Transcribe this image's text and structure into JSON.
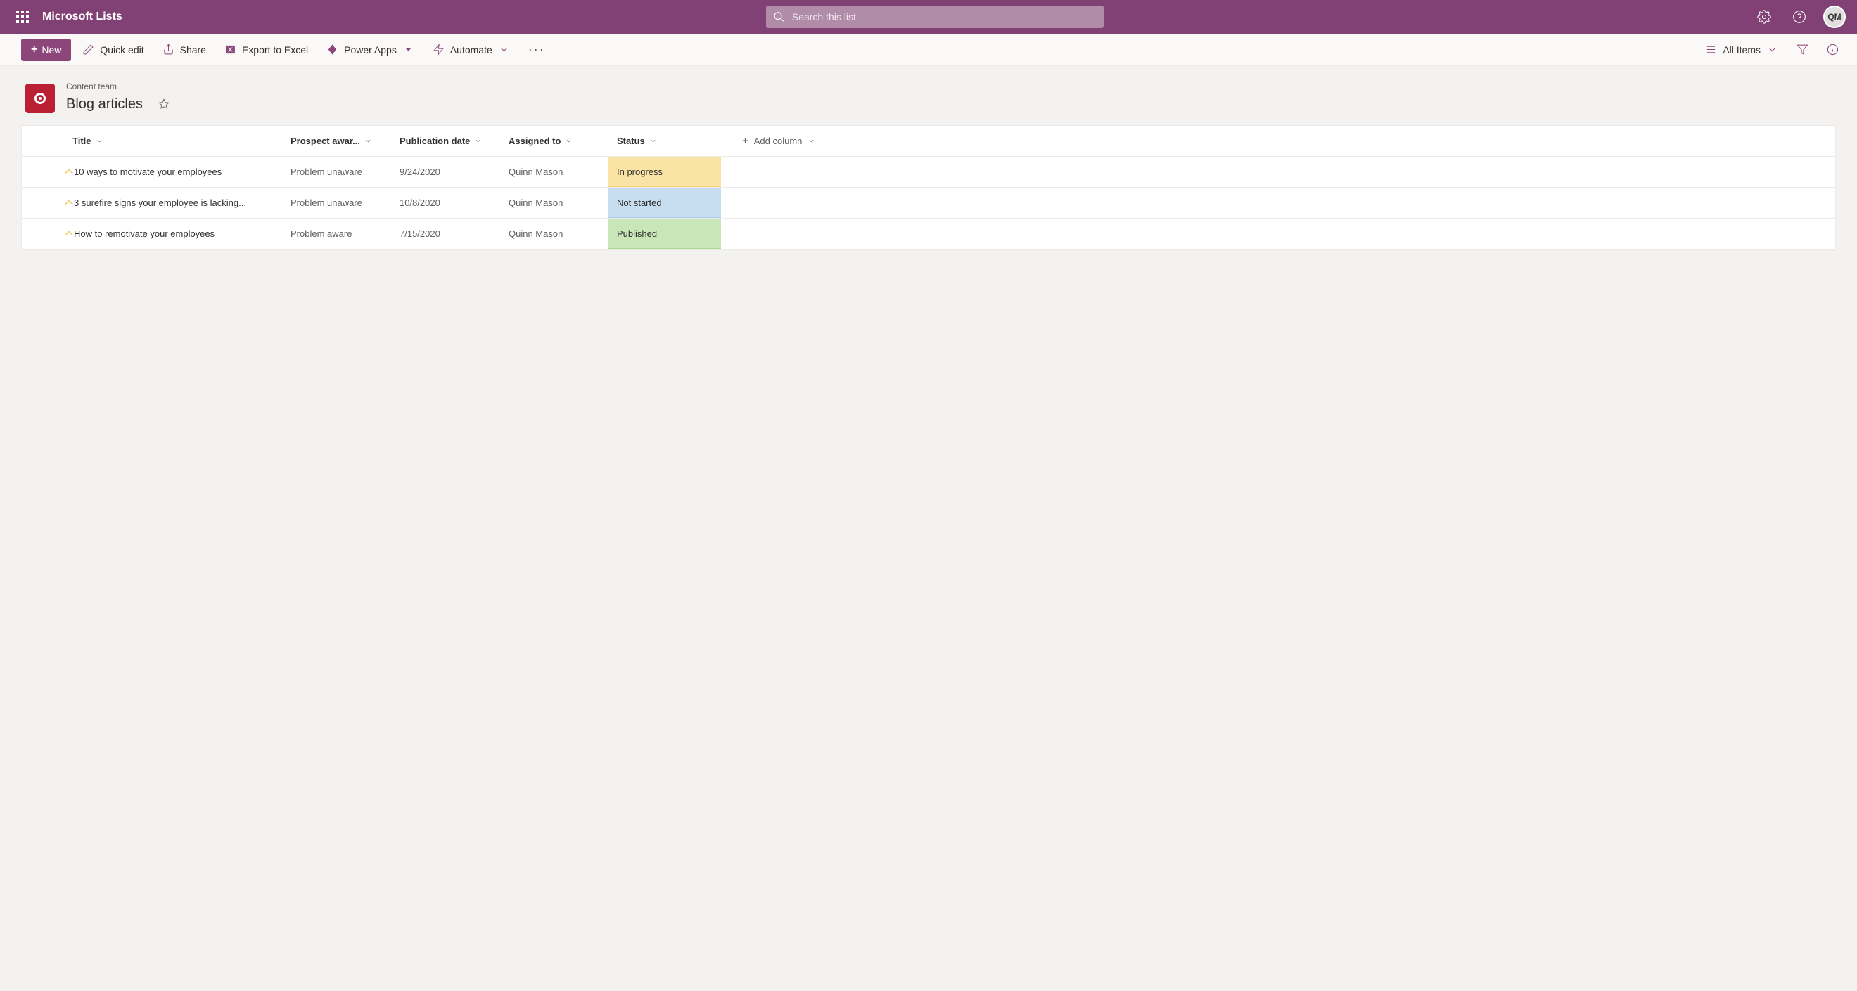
{
  "header": {
    "appTitle": "Microsoft Lists",
    "searchPlaceholder": "Search this list",
    "avatarInitials": "QM"
  },
  "commandBar": {
    "newLabel": "New",
    "quickEditLabel": "Quick edit",
    "shareLabel": "Share",
    "exportLabel": "Export to Excel",
    "powerAppsLabel": "Power Apps",
    "automateLabel": "Automate",
    "viewLabel": "All Items"
  },
  "listHeader": {
    "teamName": "Content team",
    "listName": "Blog articles"
  },
  "columns": {
    "title": "Title",
    "prospect": "Prospect awar...",
    "date": "Publication date",
    "assigned": "Assigned to",
    "status": "Status",
    "add": "Add column"
  },
  "rows": [
    {
      "title": "10 ways to motivate your employees",
      "prospect": "Problem unaware",
      "date": "9/24/2020",
      "assigned": "Quinn Mason",
      "status": "In progress",
      "statusClass": "status-inprogress"
    },
    {
      "title": "3 surefire signs your employee is lacking...",
      "prospect": "Problem unaware",
      "date": "10/8/2020",
      "assigned": "Quinn Mason",
      "status": "Not started",
      "statusClass": "status-notstarted"
    },
    {
      "title": "How to remotivate your employees",
      "prospect": "Problem aware",
      "date": "7/15/2020",
      "assigned": "Quinn Mason",
      "status": "Published",
      "statusClass": "status-published"
    }
  ]
}
